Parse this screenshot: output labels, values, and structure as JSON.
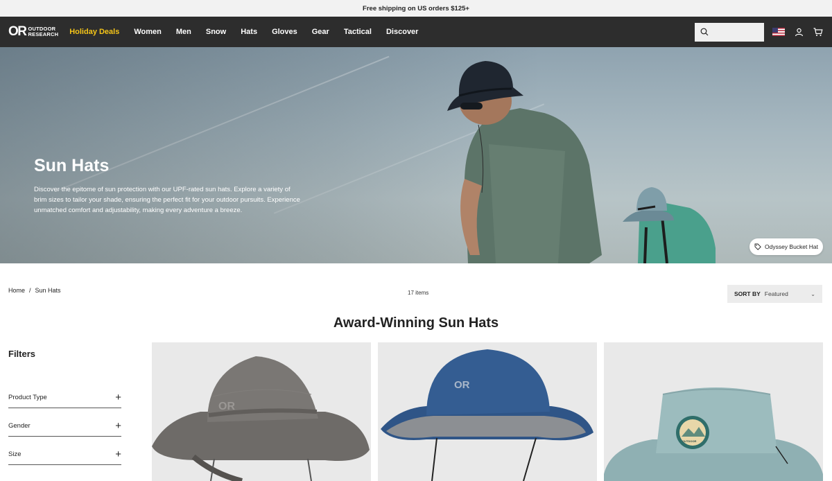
{
  "promo": {
    "text": "Free shipping on US orders $125+"
  },
  "brand": {
    "mark": "OR",
    "line1": "OUTDOOR",
    "line2": "RESEARCH"
  },
  "nav": {
    "items": [
      {
        "label": "Holiday Deals",
        "highlight": true
      },
      {
        "label": "Women"
      },
      {
        "label": "Men"
      },
      {
        "label": "Snow"
      },
      {
        "label": "Hats"
      },
      {
        "label": "Gloves"
      },
      {
        "label": "Gear"
      },
      {
        "label": "Tactical"
      },
      {
        "label": "Discover"
      }
    ],
    "search_value": "",
    "highlight_color": "#f5c518"
  },
  "hero": {
    "title": "Sun Hats",
    "description": "Discover the epitome of sun protection with our UPF-rated sun hats. Explore a variety of brim sizes to tailor your shade, ensuring the perfect fit for your outdoor pursuits. Experience unmatched comfort and adjustability, making every adventure a breeze.",
    "product_tag": "Odyssey Bucket Hat"
  },
  "breadcrumb": {
    "home": "Home",
    "separator": "/",
    "current": "Sun Hats"
  },
  "listing": {
    "item_count": "17 items",
    "sort_label": "SORT BY",
    "sort_value": "Featured",
    "section_title": "Award-Winning Sun Hats"
  },
  "filters": {
    "title": "Filters",
    "items": [
      "Product Type",
      "Gender",
      "Size"
    ]
  },
  "products": [
    {
      "hat_color": "#6e6b68",
      "brim_under": "#5a5855"
    },
    {
      "hat_color": "#2f5587",
      "brim_under": "#8c8f93"
    },
    {
      "hat_color": "#8fb0b3",
      "brim_under": "#7d9da0"
    }
  ]
}
